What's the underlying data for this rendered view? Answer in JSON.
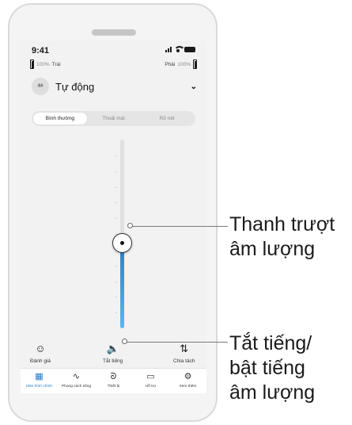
{
  "status_bar": {
    "time": "9:41"
  },
  "hearing_aids": {
    "left": {
      "percent": "100%",
      "label": "Trái"
    },
    "right": {
      "percent": "100%",
      "label": "Phải"
    }
  },
  "program": {
    "icon_text": "ᵈᴵᴬ",
    "name": "Tự động",
    "chevron": "⌄"
  },
  "sound_modes": {
    "options": [
      "Bình thường",
      "Thoải mái",
      "Rõ nét"
    ],
    "selected": "Bình thường"
  },
  "volume": {
    "level": 0.45
  },
  "actions": {
    "rate": {
      "icon": "☺",
      "label": "Đánh giá"
    },
    "mute": {
      "icon": "🔈",
      "label": "Tắt tiếng"
    },
    "split": {
      "icon": "⇅",
      "label": "Chia tách"
    }
  },
  "nav": {
    "home": "Màn hình chính",
    "lifestyle": "Phong cách sống",
    "devices": "Thiết bị",
    "support": "Hỗ trợ",
    "more": "Xem thêm",
    "active": "home"
  },
  "annotations": {
    "slider_line1": "Thanh trượt",
    "slider_line2": "âm lượng",
    "mute_line1": "Tắt tiếng/",
    "mute_line2": "bật tiếng",
    "mute_line3": "âm lượng"
  }
}
